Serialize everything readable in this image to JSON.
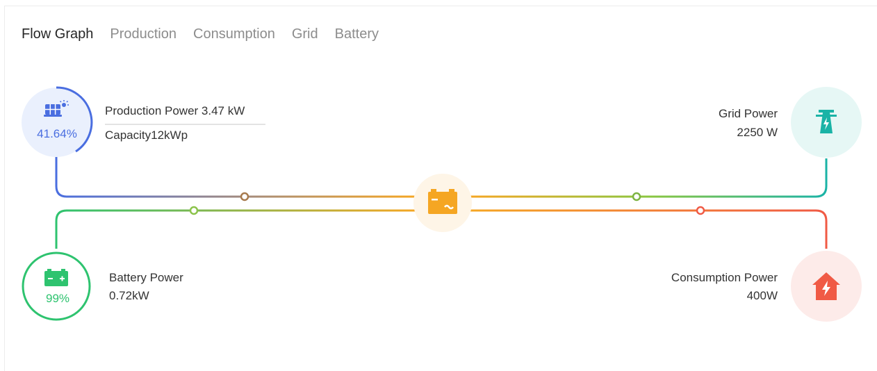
{
  "tabs": [
    {
      "label": "Flow Graph",
      "active": true
    },
    {
      "label": "Production",
      "active": false
    },
    {
      "label": "Consumption",
      "active": false
    },
    {
      "label": "Grid",
      "active": false
    },
    {
      "label": "Battery",
      "active": false
    }
  ],
  "production": {
    "power_label": "Production Power",
    "power_value": "3.47 kW",
    "capacity_label": "Capacity12kWp",
    "percent": "41.64%",
    "percent_value": 41.64,
    "icon": "solar-panel-icon",
    "color": "#4a6ee0"
  },
  "grid": {
    "label": "Grid Power",
    "value": "2250 W",
    "icon": "power-tower-icon",
    "color": "#1ab3a6"
  },
  "battery": {
    "label": "Battery Power",
    "value": "0.72kW",
    "percent": "99%",
    "percent_value": 99,
    "icon": "battery-icon",
    "color": "#2ec36f"
  },
  "consumption": {
    "label": "Consumption Power",
    "value": "400W",
    "icon": "house-lightning-icon",
    "color": "#f05a45"
  },
  "inverter": {
    "icon": "inverter-icon",
    "color": "#f5a623"
  }
}
